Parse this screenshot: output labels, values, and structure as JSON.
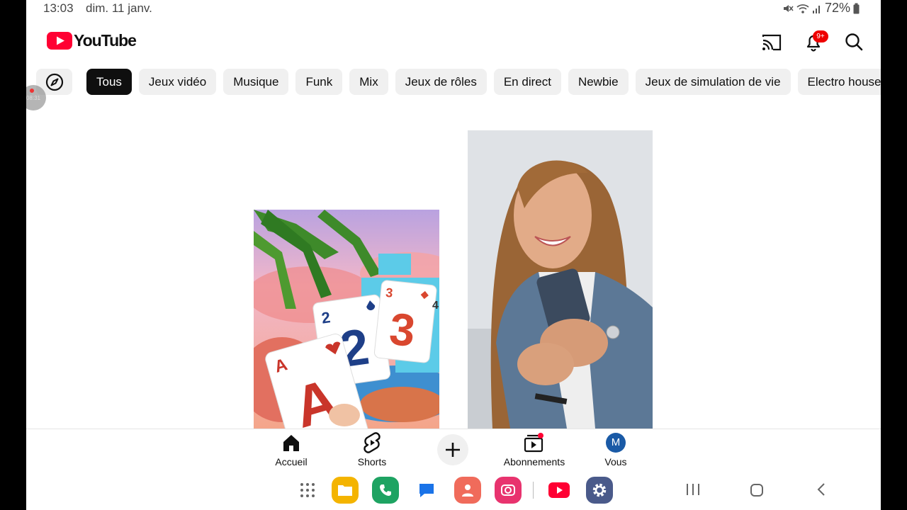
{
  "status_bar": {
    "time": "13:03",
    "date": "dim. 11 janv.",
    "battery": "72%",
    "icons": [
      "mute-icon",
      "wifi-icon",
      "signal-icon",
      "battery-icon"
    ]
  },
  "header": {
    "logo_text": "YouTube",
    "notification_badge": "9+",
    "icons": [
      "cast-icon",
      "bell-icon",
      "search-icon"
    ]
  },
  "floating_bubble": {
    "text": "08:31"
  },
  "chips": [
    {
      "label": "Tous",
      "active": true
    },
    {
      "label": "Jeux vidéo"
    },
    {
      "label": "Musique"
    },
    {
      "label": "Funk"
    },
    {
      "label": "Mix"
    },
    {
      "label": "Jeux de rôles"
    },
    {
      "label": "En direct"
    },
    {
      "label": "Newbie"
    },
    {
      "label": "Jeux de simulation de vie"
    },
    {
      "label": "Electro house"
    }
  ],
  "shorts": [
    {
      "cards": [
        "A",
        "2",
        "3",
        "4"
      ]
    },
    {
      "description": "woman-using-phone"
    }
  ],
  "bottom_nav": {
    "home": "Accueil",
    "shorts": "Shorts",
    "subscriptions": "Abonnements",
    "you": "Vous",
    "avatar_letter": "M"
  },
  "colors": {
    "brand_red": "#ff0033",
    "chip_active_bg": "#0f0f0f",
    "chip_bg": "#f0f0f0"
  }
}
